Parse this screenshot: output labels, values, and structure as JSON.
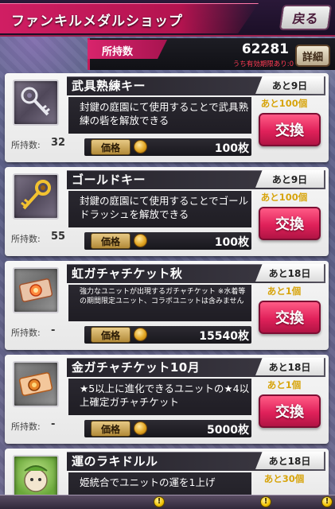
{
  "header": {
    "title": "ファンキルメダルショップ",
    "back_label": "戻る"
  },
  "holdings": {
    "label": "所持数",
    "value": "62281",
    "note": "うち有効期限あり:0",
    "details_label": "詳細"
  },
  "common": {
    "owned_label": "所持数:",
    "price_label": "価格",
    "exchange_label": "交換",
    "unit": "枚"
  },
  "items": [
    {
      "name": "武具熟練キー",
      "deadline": "あと9日",
      "description": "封鍵の庭園にて使用することで武具熟練の砦を解放できる",
      "stock": "あと100個",
      "owned": "32",
      "price": "100枚",
      "icon": "silver-key-icon"
    },
    {
      "name": "ゴールドキー",
      "deadline": "あと9日",
      "description": "封鍵の庭園にて使用することでゴールドラッシュを解放できる",
      "stock": "あと100個",
      "owned": "55",
      "price": "100枚",
      "icon": "gold-key-icon"
    },
    {
      "name": "虹ガチャチケット秋",
      "deadline": "あと18日",
      "description": "強力なユニットが出現するガチャチケット ※水着等の期間限定ユニット、コラボユニットは含みません",
      "stock": "あと1個",
      "owned": "-",
      "price": "15540枚",
      "icon": "rainbow-ticket-icon"
    },
    {
      "name": "金ガチャチケット10月",
      "deadline": "あと18日",
      "description": "★5以上に進化できるユニットの★4以上確定ガチャチケット",
      "stock": "あと1個",
      "owned": "-",
      "price": "5000枚",
      "icon": "gold-ticket-icon"
    },
    {
      "name": "運のラキドルル",
      "deadline": "あと18日",
      "description": "姫統合でユニットの運を1上げ",
      "stock": "あと30個",
      "icon": "rakidoruru-icon"
    }
  ],
  "colors": {
    "accent": "#d01e63",
    "exchange": "#e0215a",
    "stock": "#d7a40b",
    "note": "#ff3b53"
  }
}
